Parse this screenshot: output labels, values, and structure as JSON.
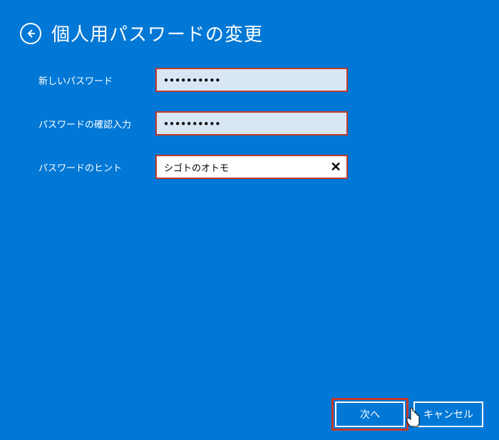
{
  "header": {
    "title": "個人用パスワードの変更"
  },
  "form": {
    "new_password": {
      "label": "新しいパスワード",
      "value": "●●●●●●●●●●"
    },
    "confirm_password": {
      "label": "パスワードの確認入力",
      "value": "●●●●●●●●●●"
    },
    "hint": {
      "label": "パスワードのヒント",
      "value": "シゴトのオトモ"
    }
  },
  "footer": {
    "next": "次へ",
    "cancel": "キャンセル"
  }
}
